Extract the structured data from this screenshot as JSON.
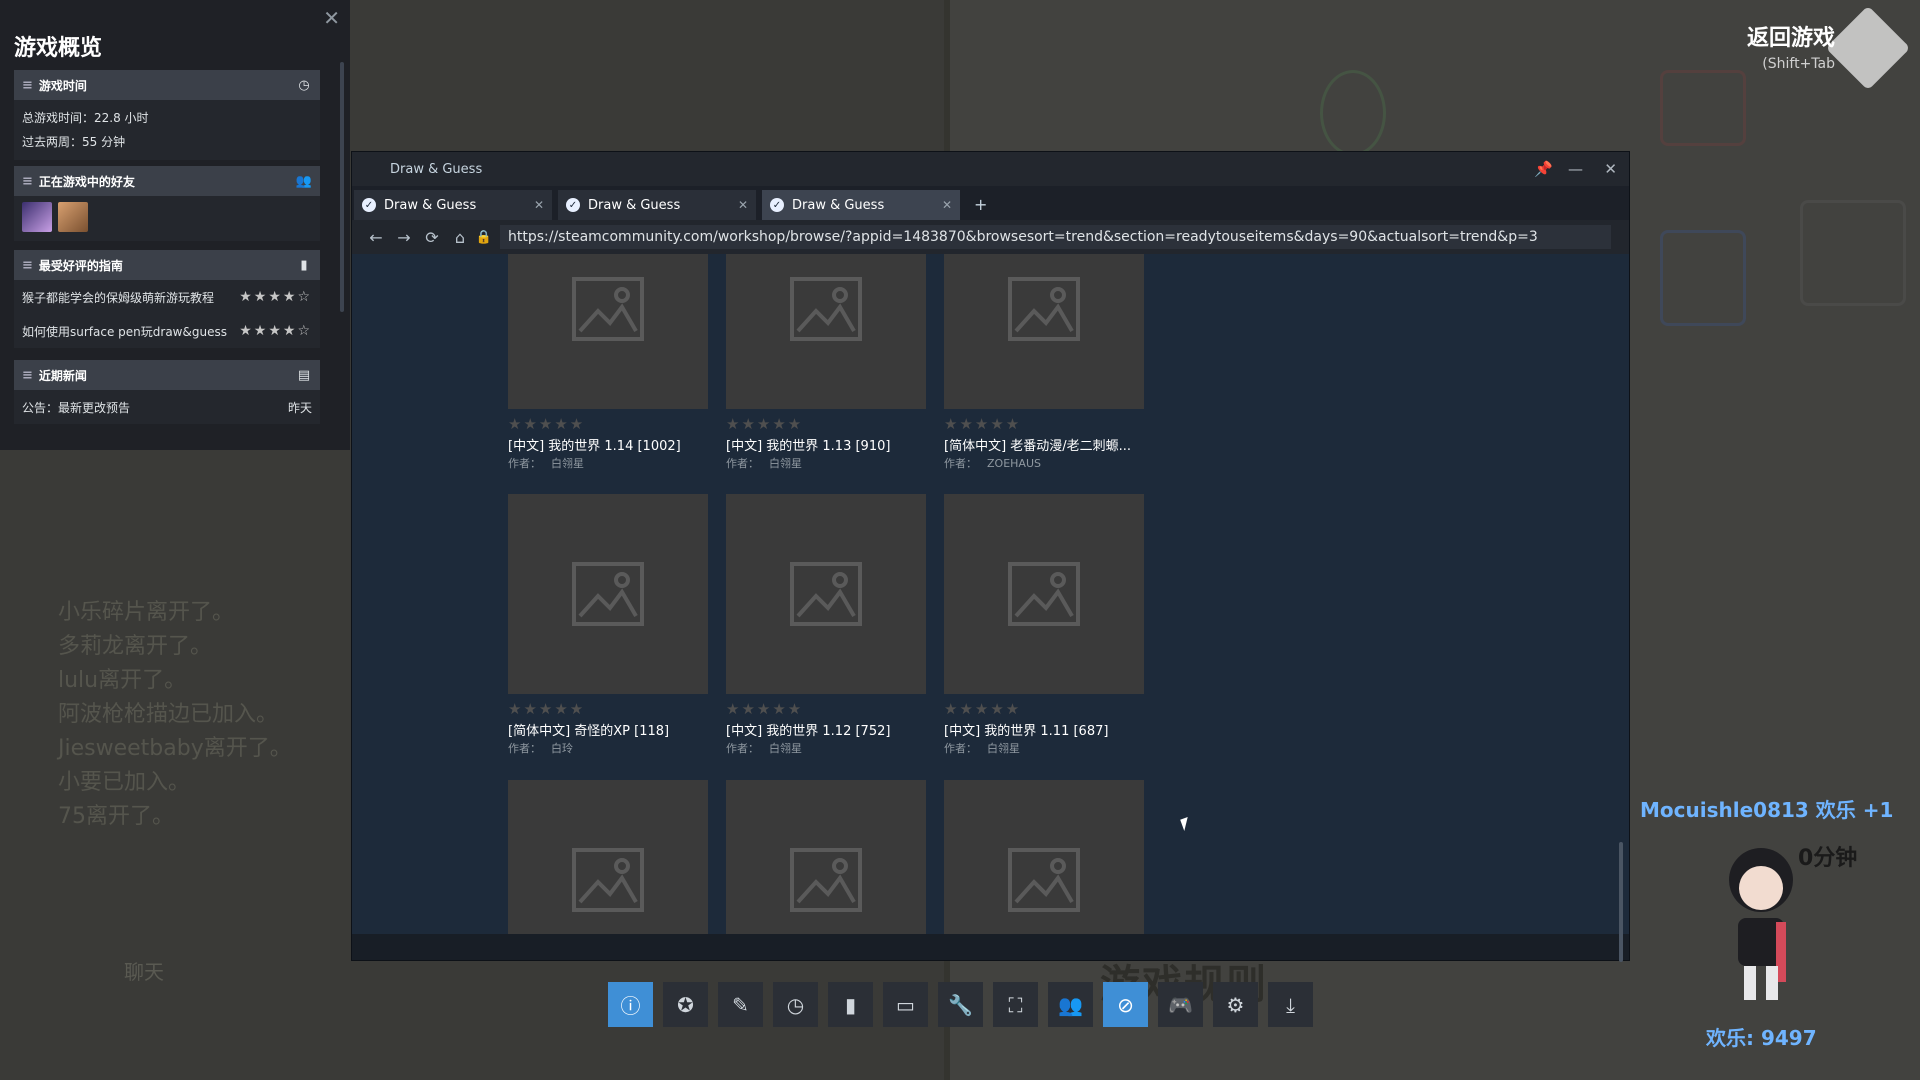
{
  "overview": {
    "title": "游戏概览",
    "playtime": {
      "header": "游戏时间",
      "total": "总游戏时间：22.8 小时",
      "recent": "过去两周：55 分钟"
    },
    "friends": {
      "header": "正在游戏中的好友"
    },
    "guides": {
      "header": "最受好评的指南",
      "items": [
        {
          "title": "猴子都能学会的保姆级萌新游玩教程",
          "stars": "★★★★☆"
        },
        {
          "title": "如何使用surface pen玩draw&guess",
          "stars": "★★★★☆"
        }
      ]
    },
    "news": {
      "header": "近期新闻",
      "items": [
        {
          "title": "公告：最新更改预告",
          "date": "昨天"
        }
      ]
    }
  },
  "return_game": {
    "label": "返回游戏",
    "shortcut": "(Shift+Tab"
  },
  "browser": {
    "window_title": "Draw & Guess",
    "tabs": [
      {
        "label": "Draw & Guess"
      },
      {
        "label": "Draw & Guess"
      },
      {
        "label": "Draw & Guess"
      }
    ],
    "new_tab": "+",
    "url": "https://steamcommunity.com/workshop/browse/?appid=1483870&browsesort=trend&section=readytouseitems&days=90&actualsort=trend&p=3",
    "items": [
      {
        "title": "[中文] 我的世界 1.14 [1002]",
        "author_label": "作者：",
        "author": "白翎星",
        "stars": "★★★★★"
      },
      {
        "title": "[中文] 我的世界 1.13 [910]",
        "author_label": "作者：",
        "author": "白翎星",
        "stars": "★★★★★"
      },
      {
        "title": "[简体中文] 老番动漫/老二刺螈...",
        "author_label": "作者：",
        "author": "ZOEHAUS",
        "stars": "★★★★★"
      },
      {
        "title": "[简体中文] 奇怪的XP [118]",
        "author_label": "作者：",
        "author": "白玲",
        "stars": "★★★★★"
      },
      {
        "title": "[中文] 我的世界 1.12 [752]",
        "author_label": "作者：",
        "author": "白翎星",
        "stars": "★★★★★"
      },
      {
        "title": "[中文] 我的世界 1.11 [687]",
        "author_label": "作者：",
        "author": "白翎星",
        "stars": "★★★★★"
      }
    ]
  },
  "chat": {
    "lines": [
      "小乐碎片离开了。",
      "多莉龙离开了。",
      "lulu离开了。",
      "阿波枪枪描边已加入。",
      "Jiesweetbaby离开了。",
      "小要已加入。",
      "75离开了。"
    ],
    "label": "聊天"
  },
  "game": {
    "rules_title": "游戏规则",
    "notification": "Mocuishle0813 欢乐 +1",
    "timer": "0分钟",
    "joy": "欢乐: 9497"
  },
  "dock": {
    "active_index": 0,
    "highlight_index": 9,
    "icons": [
      "info-icon",
      "achievements-icon",
      "notes-icon",
      "clock-icon",
      "guides-icon",
      "chat-icon",
      "wrench-icon",
      "screenshot-icon",
      "friends-icon",
      "browser-icon",
      "controller-icon",
      "settings-icon",
      "download-icon"
    ]
  },
  "colors": {
    "steam_bg": "#1b2838",
    "accent_blue": "#3f8fd6",
    "notify_blue": "#6fb4ff"
  }
}
